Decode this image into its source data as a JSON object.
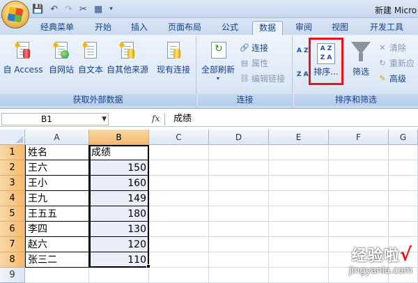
{
  "window": {
    "title": "新建 Micro"
  },
  "tabs": [
    {
      "label": "经典菜单",
      "active": false
    },
    {
      "label": "开始",
      "active": false
    },
    {
      "label": "插入",
      "active": false
    },
    {
      "label": "页面布局",
      "active": false
    },
    {
      "label": "公式",
      "active": false
    },
    {
      "label": "数据",
      "active": true
    },
    {
      "label": "审阅",
      "active": false
    },
    {
      "label": "视图",
      "active": false
    },
    {
      "label": "开发工具",
      "active": false
    }
  ],
  "ribbon": {
    "external": {
      "group_label": "获取外部数据",
      "buttons": [
        "自 Access",
        "自网站",
        "自文本",
        "自其他来源",
        "现有连接"
      ]
    },
    "connections": {
      "group_label": "连接",
      "refresh_all": "全部刷新",
      "connect": "连接",
      "properties": "属性",
      "edit_links": "编辑链接"
    },
    "sortfilter": {
      "group_label": "排序和筛选",
      "sort": "排序...",
      "filter": "筛选",
      "clear": "清除",
      "reapply": "重新应",
      "advanced": "高级",
      "az_icon_text": "A Z",
      "za_icon_text": "Z A"
    }
  },
  "formula_bar": {
    "name_box": "B1",
    "fx": "fx",
    "formula": "成绩"
  },
  "sheet": {
    "columns": [
      "A",
      "B",
      "C",
      "D",
      "E",
      "F",
      "G"
    ],
    "selected_column": "B",
    "rows": [
      {
        "n": "1",
        "a": "姓名",
        "b": "成绩"
      },
      {
        "n": "2",
        "a": "王六",
        "b": "150"
      },
      {
        "n": "3",
        "a": "王小",
        "b": "160"
      },
      {
        "n": "4",
        "a": "王九",
        "b": "149"
      },
      {
        "n": "5",
        "a": "王五五",
        "b": "180"
      },
      {
        "n": "6",
        "a": "李四",
        "b": "130"
      },
      {
        "n": "7",
        "a": "赵六",
        "b": "120"
      },
      {
        "n": "8",
        "a": "张三二",
        "b": "110"
      },
      {
        "n": "9",
        "a": "",
        "b": ""
      }
    ]
  },
  "watermark": {
    "text": "经验啦",
    "check": "√",
    "url": "jingyanla.com"
  },
  "colors": {
    "accent_red": "#e8151c",
    "ribbon_blue": "#15428b",
    "selected_header": "#f7b96c"
  }
}
